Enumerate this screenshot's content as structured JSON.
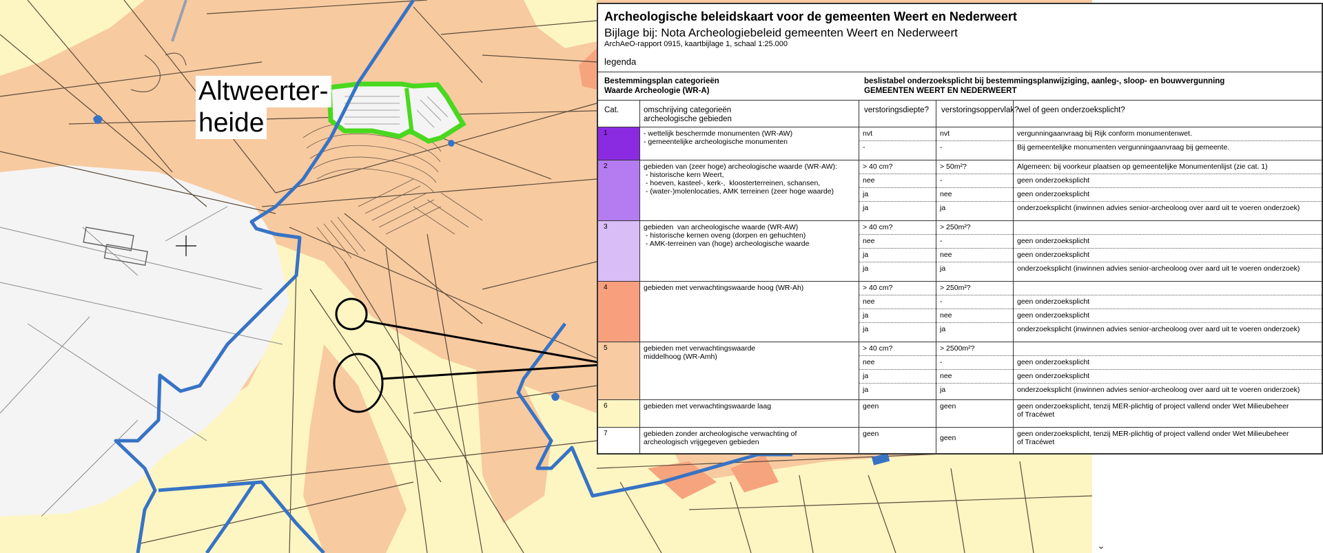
{
  "map": {
    "place_label_lines": [
      "Altweerter-",
      "heide"
    ],
    "colors": {
      "zone_orange": "#f8caa0",
      "zone_salmon": "#f6a47e",
      "zone_yellow": "#fdf6c3",
      "zone_white": "#f4f4f4",
      "boundary_blue": "#3773c5",
      "highlight_green": "#49d81f",
      "line_black": "#000000"
    }
  },
  "legend": {
    "title": "Archeologische beleidskaart voor de gemeenten Weert en Nederweert",
    "subtitle": "Bijlage bij: Nota Archeologiebeleid gemeenten Weert en Nederweert",
    "report": "ArchAeO-rapport 0915, kaartbijlage 1, schaal 1:25.000",
    "legenda_label": "legenda",
    "header_left_1": "Bestemmingsplan categorieën",
    "header_left_2": "Waarde Archeologie (WR-A)",
    "header_right_1": "beslistabel onderzoeksplicht bij bestemmingsplanwijziging, aanleg-, sloop- en bouwvergunning",
    "header_right_2": "GEMEENTEN WEERT EN NEDERWEERT",
    "col_cat": "Cat.",
    "col_desc_1": "omschrijving categorieën",
    "col_desc_2": "archeologische gebieden",
    "col_depth": "verstoringsdiepte?",
    "col_area": "verstoringsoppervlak?",
    "col_obligation": "wel of geen onderzoeksplicht?",
    "categories": [
      {
        "num": "1",
        "color": "#8a2be2",
        "desc": "- wettelijk beschermde monumenten (WR-AW)\n- gemeentelijke archeologische monumenten",
        "rows": [
          {
            "depth": "nvt",
            "area": "nvt",
            "obligation": "vergunningaanvraag bij Rijk conform monumentenwet."
          },
          {
            "depth": "-",
            "area": "-",
            "obligation": "Bij gemeentelijke monumenten vergunningaanvraag bij gemeente."
          }
        ]
      },
      {
        "num": "2",
        "color": "#b57bf0",
        "desc": "gebieden van (zeer hoge) archeologische waarde (WR-AW):\n - historische kern Weert,\n - hoeven, kasteel-, kerk-,  kloosterterreinen, schansen,\n - (water-)molenlocaties, AMK terreinen (zeer hoge waarde)",
        "rows": [
          {
            "depth": "> 40 cm?",
            "area": "> 50m²?",
            "obligation": "Algemeen: bij voorkeur plaatsen op gemeentelijke Monumentenlijst (zie cat. 1)"
          },
          {
            "depth": "nee",
            "area": "-",
            "obligation": "geen onderzoeksplicht"
          },
          {
            "depth": "ja",
            "area": "nee",
            "obligation": "geen onderzoeksplicht"
          },
          {
            "depth": "ja",
            "area": "ja",
            "obligation": "onderzoeksplicht (inwinnen advies senior-archeoloog over aard uit te voeren onderzoek)"
          }
        ]
      },
      {
        "num": "3",
        "color": "#d9bdf6",
        "desc": "gebieden  van archeologische waarde (WR-AW)\n - historische kernen oveng (dorpen en gehuchten)\n - AMK-terreinen van (hoge) archeologische waarde",
        "rows": [
          {
            "depth": "> 40 cm?",
            "area": "> 250m²?",
            "obligation": ""
          },
          {
            "depth": "nee",
            "area": "-",
            "obligation": "geen onderzoeksplicht"
          },
          {
            "depth": "ja",
            "area": "nee",
            "obligation": "geen onderzoeksplicht"
          },
          {
            "depth": "ja",
            "area": "ja",
            "obligation": "onderzoeksplicht (inwinnen advies senior-archeoloog over aard uit te voeren onderzoek)"
          }
        ]
      },
      {
        "num": "4",
        "color": "#f8a07e",
        "desc": "gebieden met verwachtingswaarde hoog (WR-Ah)",
        "rows": [
          {
            "depth": "> 40 cm?",
            "area": "> 250m²?",
            "obligation": ""
          },
          {
            "depth": "nee",
            "area": "-",
            "obligation": "geen onderzoeksplicht"
          },
          {
            "depth": "ja",
            "area": "nee",
            "obligation": "geen onderzoeksplicht"
          },
          {
            "depth": "ja",
            "area": "ja",
            "obligation": "onderzoeksplicht (inwinnen advies senior-archeoloog over aard uit te voeren onderzoek)"
          }
        ]
      },
      {
        "num": "5",
        "color": "#f9cba2",
        "desc": "gebieden met verwachtingswaarde\nmiddelhoog (WR-Amh)",
        "rows": [
          {
            "depth": "> 40 cm?",
            "area": "> 2500m²?",
            "obligation": ""
          },
          {
            "depth": "nee",
            "area": "-",
            "obligation": "geen onderzoeksplicht"
          },
          {
            "depth": "ja",
            "area": "nee",
            "obligation": "geen onderzoeksplicht"
          },
          {
            "depth": "ja",
            "area": "ja",
            "obligation": "onderzoeksplicht (inwinnen advies senior-archeoloog over aard uit te voeren onderzoek)"
          }
        ]
      },
      {
        "num": "6",
        "color": "#fdf6c3",
        "desc": "gebieden met verwachtingswaarde laag",
        "rows": [
          {
            "depth": "geen",
            "area": "geen",
            "obligation": "geen onderzoeksplicht, tenzij MER-plichtig of project vallend onder Wet Milieubeheer\nof Tracéwet"
          }
        ]
      },
      {
        "num": "7",
        "color": "#ffffff",
        "desc": "gebieden zonder archeologische verwachting of\narcheologisch vrijgegeven gebieden",
        "rows": [
          {
            "depth": "geen",
            "area": "geen",
            "obligation": "geen onderzoeksplicht, tenzij MER-plichtig of project vallend onder Wet Milieubeheer\nof Tracéwet"
          }
        ]
      }
    ]
  },
  "ui": {
    "scroll_arrow": "⌄"
  }
}
